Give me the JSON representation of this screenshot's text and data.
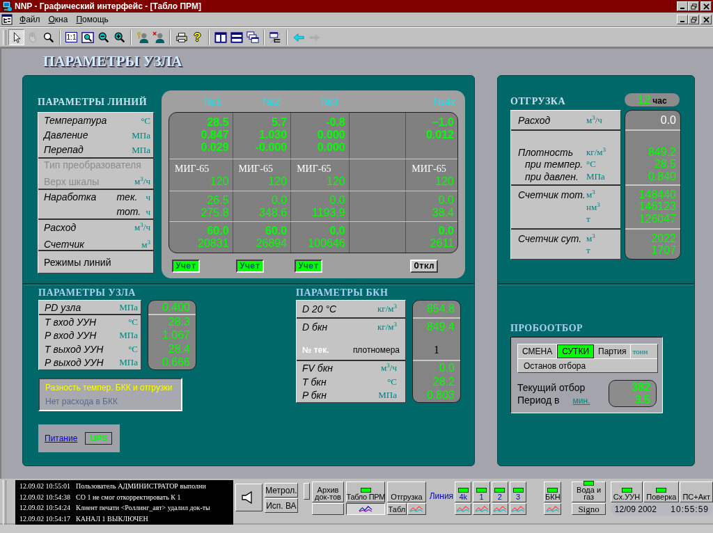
{
  "window": {
    "title": "NNP - Графический интерфейс - [Табло ПРМ]"
  },
  "menu": [
    {
      "label": "Файл"
    },
    {
      "label": "Окна"
    },
    {
      "label": "Помощь"
    }
  ],
  "toolbar": [
    [
      {
        "kind": "pointer",
        "selected": true,
        "disabled": false
      },
      {
        "kind": "hand",
        "selected": false,
        "disabled": true
      },
      {
        "kind": "magnifier",
        "selected": false,
        "disabled": false
      }
    ],
    [
      {
        "kind": "actual-size",
        "label": "1:1",
        "selected": false,
        "disabled": false
      },
      {
        "kind": "zoom-fit",
        "selected": false,
        "disabled": false
      },
      {
        "kind": "zoom-out",
        "selected": false,
        "disabled": false
      },
      {
        "kind": "zoom-in",
        "selected": false,
        "disabled": false
      }
    ],
    [
      {
        "kind": "user-key",
        "selected": false,
        "disabled": false
      },
      {
        "kind": "user-remove",
        "selected": false,
        "disabled": false
      }
    ],
    [
      {
        "kind": "print",
        "selected": false,
        "disabled": false
      },
      {
        "kind": "help",
        "label": "?",
        "selected": false,
        "disabled": false
      }
    ],
    [
      {
        "kind": "tile-vertical",
        "selected": false,
        "disabled": false
      },
      {
        "kind": "tile-horizontal",
        "selected": false,
        "disabled": false
      },
      {
        "kind": "cascade",
        "selected": false,
        "disabled": false
      }
    ],
    [
      {
        "kind": "tree-window",
        "selected": false,
        "disabled": false
      }
    ],
    [
      {
        "kind": "back",
        "selected": false,
        "disabled": false
      },
      {
        "kind": "forward",
        "selected": false,
        "disabled": true
      }
    ]
  ],
  "page_title": "ПАРАМЕТРЫ УЗЛА",
  "lines_panel": {
    "title": "ПАРАМЕТРЫ ЛИНИЙ",
    "label_groups": [
      {
        "disabled": false,
        "rows": [
          {
            "label": "Температура",
            "unit": "°C"
          },
          {
            "label": "Давление",
            "unit": "МПа"
          },
          {
            "label": "Перепад",
            "unit": "МПа"
          }
        ]
      },
      {
        "disabled": true,
        "rows": [
          {
            "label": "Тип преобразователя"
          },
          {
            "label": "Верх шкалы",
            "unit": "м$^{3}$/ч"
          }
        ]
      },
      {
        "disabled": false,
        "rows": [
          {
            "label": "Наработка",
            "sublabel": "тек.",
            "unit": "ч"
          },
          {
            "sublabel": "тот.",
            "unit": "ч"
          }
        ]
      },
      {
        "disabled": false,
        "rows": [
          {
            "label": "Расход",
            "unit": "м$^{3}$/ч"
          },
          {
            "label": "Счетчик",
            "unit": "м$^{3}$"
          }
        ]
      }
    ],
    "modes_label": "Режимы линий",
    "columns": [
      {
        "header": "№1",
        "readings": [
          "28.5",
          "0.847",
          "0.029"
        ],
        "transducer": "МИГ-65",
        "scale": "120",
        "runtime": [
          "26.5",
          "275.8"
        ],
        "flow": "60.0",
        "counter": "20831",
        "mode": {
          "label": "Учет",
          "on": true
        }
      },
      {
        "header": "№2",
        "readings": [
          "5.7",
          "1.030",
          "-0.000"
        ],
        "transducer": "МИГ-65",
        "scale": "120",
        "runtime": [
          "0.0",
          "348.6"
        ],
        "flow": "60.0",
        "counter": "26894",
        "mode": {
          "label": "Учет",
          "on": true
        }
      },
      {
        "header": "№3",
        "readings": [
          "-0.8",
          "0.000",
          "0.000"
        ],
        "transducer": "МИГ-65",
        "scale": "120",
        "runtime": [
          "0.0",
          "1193.9"
        ],
        "flow": "0.0",
        "counter": "100646",
        "mode": {
          "label": "Учет",
          "on": true
        }
      },
      {
        "header": "№4к",
        "readings": [
          "−1.0",
          "0.012"
        ],
        "transducer": "МИГ-65",
        "scale": "120",
        "runtime": [
          "0.0",
          "38.4"
        ],
        "flow": "0.0",
        "counter": "2611",
        "mode": {
          "label": "Откл",
          "on": false
        }
      }
    ]
  },
  "shipment": {
    "title": "ОТГРУЗКА",
    "hour": {
      "value": "12",
      "unit": "час"
    },
    "groups": [
      {
        "labels": [
          "Расход"
        ],
        "units": [
          "м$^{3}$/ч"
        ],
        "values": [
          "0.0"
        ]
      },
      {
        "labels": [
          "Плотность",
          "при темпер.",
          "при давлен."
        ],
        "units": [
          "кг/м$^{3}$",
          "°C",
          "МПа"
        ],
        "values": [
          "849.2",
          "28.5",
          "0.840"
        ]
      },
      {
        "labels": [
          "Счетчик тот."
        ],
        "units": [
          "м$^{3}$",
          "нм$^{3}$",
          "т"
        ],
        "values": [
          "148440",
          "146123",
          "126047"
        ]
      },
      {
        "labels": [
          "Счетчик сут."
        ],
        "units": [
          "м$^{3}$",
          "т"
        ],
        "values": [
          "2022",
          "1707"
        ]
      }
    ]
  },
  "node_params": {
    "title": "ПАРАМЕТРЫ УЗЛА",
    "groups": [
      [
        {
          "label": "PD узла",
          "unit": "МПа",
          "value": "0.400"
        }
      ],
      [
        {
          "label": "T вход УУН",
          "unit": "°C",
          "value": "28.3"
        },
        {
          "label": "P вход УУН",
          "unit": "МПа",
          "value": "1.067"
        },
        {
          "label": "T выход УУН",
          "unit": "°C",
          "value": "28.4"
        },
        {
          "label": "P выход УУН",
          "unit": "МПа",
          "value": "0.666"
        }
      ]
    ],
    "alarms": [
      {
        "text": "Разность темпер. БКК и отгрузки",
        "active": true
      },
      {
        "text": "Нет расхода в БКК",
        "active": false
      }
    ],
    "power": {
      "link": "Питание",
      "source": "UPS"
    }
  },
  "bkn_params": {
    "title": "ПАРАМЕТРЫ БКН",
    "groups": [
      [
        {
          "kind": "param",
          "label": "D 20 °C",
          "unit": "кг/м$^{3}$",
          "value": "854.8"
        }
      ],
      [
        {
          "kind": "param",
          "label": "D бкн",
          "unit": "кг/м$^{3}$",
          "value": "849.4"
        },
        {
          "kind": "meter",
          "label": "№ тек.",
          "sublabel": "плотномера",
          "value": "1"
        }
      ],
      [
        {
          "kind": "param",
          "label": "FV бкн",
          "unit": "м$^{3}$/ч",
          "value": "0.0"
        },
        {
          "kind": "param",
          "label": "T бкн",
          "unit": "°C",
          "value": "28.2"
        },
        {
          "kind": "param",
          "label": "P бкн",
          "unit": "МПа",
          "value": "0.803"
        }
      ]
    ]
  },
  "sampling": {
    "title": "ПРОБООТБОР",
    "tabs": [
      {
        "label": "СМЕНА",
        "selected": false
      },
      {
        "label": "СУТКИ",
        "selected": true
      },
      {
        "label": "Партия",
        "selected": false
      }
    ],
    "unit": "тонн",
    "stop": "Останов отбора",
    "current_label": "Текущий отбор",
    "current_value": "382",
    "period_label": "Период в",
    "period_unit": "мин.",
    "period_value": "3.5"
  },
  "status_bar": {
    "log": [
      {
        "time": "12.09.02 10:55:01",
        "text": "Пользователь АДМИНИСТРАТОР выполни"
      },
      {
        "time": "12.09.02 10:54:38",
        "text": "СО 1 не смог откорректировать К 1"
      },
      {
        "time": "12.09.02 10:54:24",
        "text": "Клиент печати <Роллинг_авт> удалил док-ты"
      },
      {
        "time": "12.09.02 10:54:17",
        "text": "КАНАЛ 1 ВЫКЛЮЧЕН"
      }
    ],
    "nav": [
      {
        "kind": "speaker"
      },
      {
        "kind": "stack",
        "buttons": [
          "Метрол.",
          "Исп. ВА"
        ]
      },
      {
        "kind": "blank"
      },
      {
        "kind": "column",
        "label": "Архив док-тов",
        "led": false,
        "below": [
          {
            "kind": "blank"
          }
        ]
      },
      {
        "kind": "column",
        "label": "Табло ПРМ",
        "led": true,
        "below": [
          {
            "kind": "chart",
            "selected": true
          }
        ]
      },
      {
        "kind": "column",
        "label": "Отгрузка",
        "led": false,
        "below": [
          {
            "kind": "text",
            "label": "Табл"
          },
          {
            "kind": "chart",
            "selected": false
          }
        ]
      },
      {
        "kind": "caption",
        "label": "Линия"
      },
      {
        "kind": "line",
        "label": "4k",
        "led": true,
        "below": [
          {
            "kind": "chart",
            "selected": false
          }
        ]
      },
      {
        "kind": "line",
        "label": "1",
        "led": true,
        "below": [
          {
            "kind": "chart",
            "selected": false
          }
        ]
      },
      {
        "kind": "line",
        "label": "2",
        "led": true,
        "below": [
          {
            "kind": "chart",
            "selected": false
          }
        ]
      },
      {
        "kind": "line",
        "label": "3",
        "led": true,
        "below": [
          {
            "kind": "chart",
            "selected": false
          }
        ]
      },
      {
        "kind": "column",
        "label": "БКН",
        "led": true,
        "below": [
          {
            "kind": "chart",
            "selected": false
          }
        ]
      },
      {
        "kind": "column",
        "label": "Вода и газ",
        "led": true,
        "below": [
          {
            "kind": "text",
            "label": "Signo"
          }
        ]
      },
      {
        "kind": "cluster",
        "buttons": [
          {
            "label": "Сх.УУН",
            "led": true
          },
          {
            "label": "Поверка",
            "led": true
          },
          {
            "label": "ПС+Акт",
            "led": false
          }
        ],
        "date": "12/09 2002",
        "time": "10:55:59"
      }
    ]
  }
}
